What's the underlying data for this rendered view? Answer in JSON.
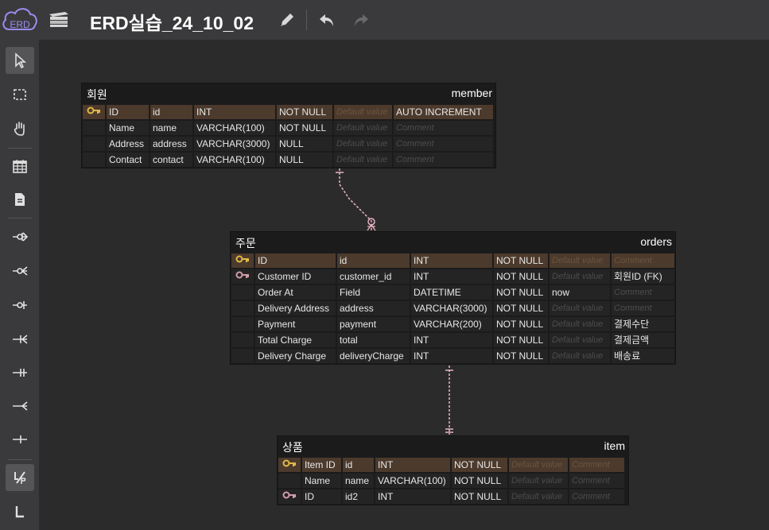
{
  "app": {
    "title": "ERD실습_24_10_02",
    "logo_text": "ERD"
  },
  "toolbar": {
    "icons": [
      "logo-cloud-icon",
      "library-books-icon",
      "pencil-icon",
      "undo-icon",
      "redo-icon"
    ]
  },
  "sidebar": {
    "tools": [
      {
        "name": "select-tool",
        "icon": "cursor-icon"
      },
      {
        "name": "drag-select-tool",
        "icon": "dashed-rect-icon"
      },
      {
        "name": "hand-tool",
        "icon": "hand-icon"
      },
      {
        "name": "table-tool",
        "icon": "table-calendar-icon"
      },
      {
        "name": "memo-tool",
        "icon": "document-icon"
      },
      {
        "name": "zero-one-n-tool",
        "icon": "relation-zero-one-n-icon"
      },
      {
        "name": "zero-n-tool",
        "icon": "relation-zero-n-icon"
      },
      {
        "name": "zero-one-tool",
        "icon": "relation-zero-one-icon"
      },
      {
        "name": "one-n-tool",
        "icon": "relation-one-n-icon"
      },
      {
        "name": "one-only-tool",
        "icon": "relation-one-only-icon"
      },
      {
        "name": "n-tool",
        "icon": "relation-n-icon"
      },
      {
        "name": "one-tool",
        "icon": "relation-one-icon"
      },
      {
        "name": "identification-tool",
        "icon": "identification-icon"
      },
      {
        "name": "start-relation-tool",
        "icon": "l-shape-icon"
      }
    ]
  },
  "tables": [
    {
      "logical": "회원",
      "physical": "member",
      "rows": [
        {
          "key": "pk",
          "name": "ID",
          "column": "id",
          "type": "INT",
          "null": "NOT NULL",
          "default": "Default value",
          "comment": "AUTO INCREMENT"
        },
        {
          "key": "",
          "name": "Name",
          "column": "name",
          "type": "VARCHAR(100)",
          "null": "NOT NULL",
          "default": "Default value",
          "comment": "Comment"
        },
        {
          "key": "",
          "name": "Address",
          "column": "address",
          "type": "VARCHAR(3000)",
          "null": "NULL",
          "default": "Default value",
          "comment": "Comment"
        },
        {
          "key": "",
          "name": "Contact",
          "column": "contact",
          "type": "VARCHAR(100)",
          "null": "NULL",
          "default": "Default value",
          "comment": "Comment"
        }
      ]
    },
    {
      "logical": "주문",
      "physical": "orders",
      "rows": [
        {
          "key": "pk",
          "name": "ID",
          "column": "id",
          "type": "INT",
          "null": "NOT NULL",
          "default": "Default value",
          "comment": "Comment"
        },
        {
          "key": "fk",
          "name": "Customer ID",
          "column": "customer_id",
          "type": "INT",
          "null": "NOT NULL",
          "default": "Default value",
          "comment": "회원ID (FK)"
        },
        {
          "key": "",
          "name": "Order At",
          "column": "Field",
          "type": "DATETIME",
          "null": "NOT NULL",
          "default": "now",
          "comment": "Comment"
        },
        {
          "key": "",
          "name": "Delivery Address",
          "column": "address",
          "type": "VARCHAR(3000)",
          "null": "NOT NULL",
          "default": "Default value",
          "comment": "Comment"
        },
        {
          "key": "",
          "name": "Payment",
          "column": "payment",
          "type": "VARCHAR(200)",
          "null": "NOT NULL",
          "default": "Default value",
          "comment": "결제수단"
        },
        {
          "key": "",
          "name": "Total Charge",
          "column": "total",
          "type": "INT",
          "null": "NOT NULL",
          "default": "Default value",
          "comment": "결제금액"
        },
        {
          "key": "",
          "name": "Delivery Charge",
          "column": "deliveryCharge",
          "type": "INT",
          "null": "NOT NULL",
          "default": "Default value",
          "comment": "배송료"
        }
      ]
    },
    {
      "logical": "상품",
      "physical": "item",
      "rows": [
        {
          "key": "pk",
          "name": "Item ID",
          "column": "id",
          "type": "INT",
          "null": "NOT NULL",
          "default": "Default value",
          "comment": "Comment"
        },
        {
          "key": "",
          "name": "Name",
          "column": "name",
          "type": "VARCHAR(100)",
          "null": "NOT NULL",
          "default": "Default value",
          "comment": "Comment"
        },
        {
          "key": "fk",
          "name": "ID",
          "column": "id2",
          "type": "INT",
          "null": "NOT NULL",
          "default": "Default value",
          "comment": "Comment"
        }
      ]
    }
  ],
  "colors": {
    "pk_key": "#e0b84a",
    "fk_key": "#d49aa8",
    "relation": "#e8b4c0"
  }
}
